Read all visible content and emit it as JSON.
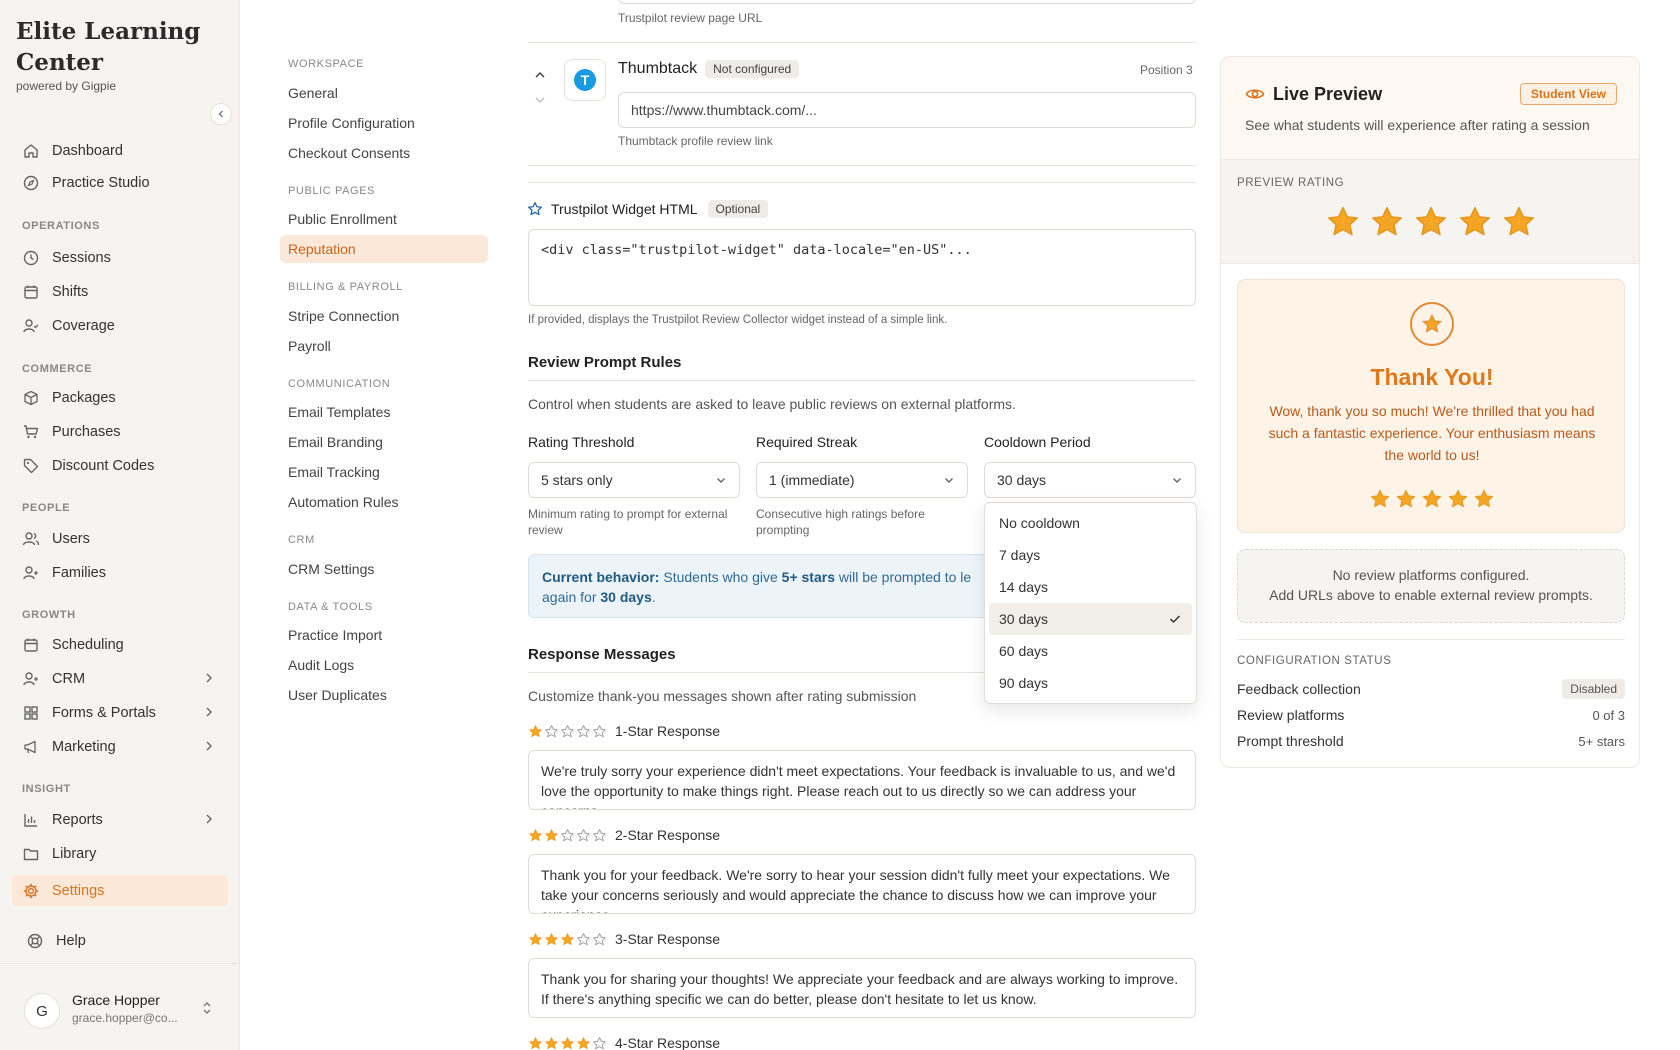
{
  "brand": {
    "name": "Elite Learning Center",
    "sub": "powered by Gigpie"
  },
  "sidebar": {
    "top": [
      {
        "label": "Dashboard",
        "icon": "home-icon"
      },
      {
        "label": "Practice Studio",
        "icon": "compass-icon"
      }
    ],
    "sections": {
      "operations": "OPERATIONS",
      "commerce": "COMMERCE",
      "people": "PEOPLE",
      "growth": "GROWTH",
      "insight": "INSIGHT"
    },
    "operations": [
      {
        "label": "Sessions"
      },
      {
        "label": "Shifts"
      },
      {
        "label": "Coverage"
      }
    ],
    "commerce": [
      {
        "label": "Packages"
      },
      {
        "label": "Purchases"
      },
      {
        "label": "Discount Codes"
      }
    ],
    "people": [
      {
        "label": "Users"
      },
      {
        "label": "Families"
      }
    ],
    "growth": [
      {
        "label": "Scheduling"
      },
      {
        "label": "CRM"
      },
      {
        "label": "Forms & Portals"
      },
      {
        "label": "Marketing"
      }
    ],
    "insight": [
      {
        "label": "Reports"
      },
      {
        "label": "Library"
      },
      {
        "label": "Settings"
      }
    ],
    "help": "Help"
  },
  "user": {
    "initial": "G",
    "name": "Grace Hopper",
    "email": "grace.hopper@co..."
  },
  "settings_nav": {
    "sections": {
      "workspace": "WORKSPACE",
      "public_pages": "PUBLIC PAGES",
      "billing": "BILLING & PAYROLL",
      "communication": "COMMUNICATION",
      "crm": "CRM",
      "data_tools": "DATA & TOOLS"
    },
    "workspace": [
      "General",
      "Profile Configuration",
      "Checkout Consents"
    ],
    "public_pages": [
      "Public Enrollment",
      "Reputation"
    ],
    "billing": [
      "Stripe Connection",
      "Payroll"
    ],
    "communication": [
      "Email Templates",
      "Email Branding",
      "Email Tracking",
      "Automation Rules"
    ],
    "crm": [
      "CRM Settings"
    ],
    "data_tools": [
      "Practice Import",
      "Audit Logs",
      "User Duplicates"
    ]
  },
  "main": {
    "trustpilot_url_helper": "Trustpilot review page URL",
    "thumbtack": {
      "name": "Thumbtack",
      "badge": "Not configured",
      "position": "Position 3",
      "placeholder": "https://www.thumbtack.com/...",
      "helper": "Thumbtack profile review link"
    },
    "widget": {
      "title": "Trustpilot Widget HTML",
      "badge": "Optional",
      "placeholder": "<div class=\"trustpilot-widget\" data-locale=\"en-US\"...",
      "helper": "If provided, displays the Trustpilot Review Collector widget instead of a simple link."
    },
    "rules": {
      "title": "Review Prompt Rules",
      "desc": "Control when students are asked to leave public reviews on external platforms.",
      "threshold_label": "Rating Threshold",
      "threshold_value": "5 stars only",
      "threshold_helper": "Minimum rating to prompt for external review",
      "streak_label": "Required Streak",
      "streak_value": "1 (immediate)",
      "streak_helper": "Consecutive high ratings before prompting",
      "cooldown_label": "Cooldown Period",
      "cooldown_value": "30 days",
      "behavior_prefix": "Current behavior:",
      "behavior_mid1": " Students who give ",
      "behavior_stars": "5+ stars",
      "behavior_mid2": " will be prompted to le",
      "behavior_mid3": "again for ",
      "behavior_days": "30 days",
      "behavior_end": "."
    },
    "cooldown_options": [
      "No cooldown",
      "7 days",
      "14 days",
      "30 days",
      "60 days",
      "90 days"
    ],
    "cooldown_selected": "30 days",
    "messages": {
      "title": "Response Messages",
      "desc": "Customize thank-you messages shown after rating submission",
      "items": [
        {
          "label": "1-Star Response",
          "stars": 1,
          "text": "We're truly sorry your experience didn't meet expectations. Your feedback is invaluable to us, and we'd love the opportunity to make things right. Please reach out to us directly so we can address your concerns."
        },
        {
          "label": "2-Star Response",
          "stars": 2,
          "text": "Thank you for your feedback. We're sorry to hear your session didn't fully meet your expectations. We take your concerns seriously and would appreciate the chance to discuss how we can improve your experience."
        },
        {
          "label": "3-Star Response",
          "stars": 3,
          "text": "Thank you for sharing your thoughts! We appreciate your feedback and are always working to improve. If there's anything specific we can do better, please don't hesitate to let us know."
        },
        {
          "label": "4-Star Response",
          "stars": 4,
          "text": ""
        }
      ]
    }
  },
  "preview": {
    "title": "Live Preview",
    "badge": "Student View",
    "subtitle": "See what students will experience after rating a session",
    "rating_label": "PREVIEW RATING",
    "rating_value": 5,
    "thanks_title": "Thank You!",
    "thanks_text": "Wow, thank you so much! We're thrilled that you had such a fantastic experience. Your enthusiasm means the world to us!",
    "empty_line1": "No review platforms configured.",
    "empty_line2": "Add URLs above to enable external review prompts.",
    "config_title": "CONFIGURATION STATUS",
    "config": [
      {
        "label": "Feedback collection",
        "value": "Disabled"
      },
      {
        "label": "Review platforms",
        "value": "0 of 3"
      },
      {
        "label": "Prompt threshold",
        "value": "5+ stars"
      }
    ]
  },
  "colors": {
    "accent": "#d9731f",
    "star": "#f5a524",
    "info": "#2f6a94"
  }
}
